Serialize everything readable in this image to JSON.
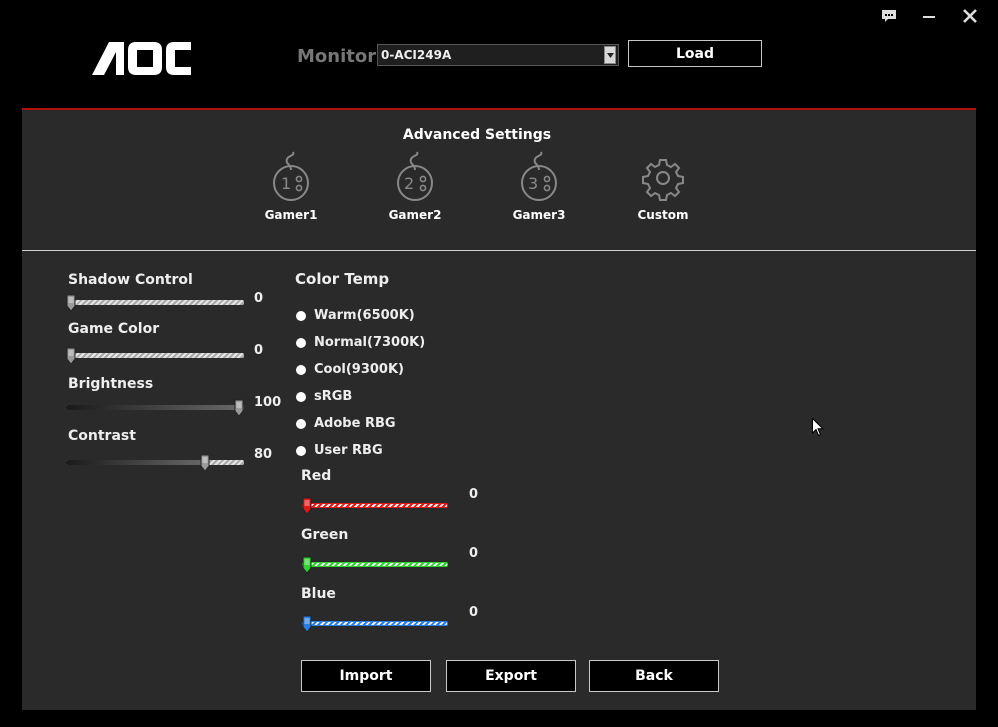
{
  "header": {
    "logo_text": "AOC",
    "monitor_label": "Monitor",
    "monitor_value": "0-ACI249A",
    "load_label": "Load"
  },
  "advanced": {
    "title": "Advanced Settings",
    "profiles": [
      {
        "label": "Gamer1",
        "number": "1"
      },
      {
        "label": "Gamer2",
        "number": "2"
      },
      {
        "label": "Gamer3",
        "number": "3"
      },
      {
        "label": "Custom"
      }
    ]
  },
  "sliders": [
    {
      "label": "Shadow Control",
      "value": "0",
      "fraction": 0.0
    },
    {
      "label": "Game Color",
      "value": "0",
      "fraction": 0.0
    },
    {
      "label": "Brightness",
      "value": "100",
      "fraction": 1.0
    },
    {
      "label": "Contrast",
      "value": "80",
      "fraction": 0.8
    }
  ],
  "color_temp": {
    "title": "Color Temp",
    "options": [
      "Warm(6500K)",
      "Normal(7300K)",
      "Cool(9300K)",
      "sRGB",
      "Adobe RBG",
      "User RBG"
    ]
  },
  "rgb": [
    {
      "label": "Red",
      "value": "0",
      "fraction": 0.0,
      "color": "#e01818"
    },
    {
      "label": "Green",
      "value": "0",
      "fraction": 0.0,
      "color": "#2fd02f"
    },
    {
      "label": "Blue",
      "value": "0",
      "fraction": 0.0,
      "color": "#2a7de0"
    }
  ],
  "footer": {
    "import_label": "Import",
    "export_label": "Export",
    "back_label": "Back"
  },
  "colors": {
    "accent_line": "#b01010",
    "panel_bg": "#2a2a2a",
    "window_bg": "#000000"
  }
}
